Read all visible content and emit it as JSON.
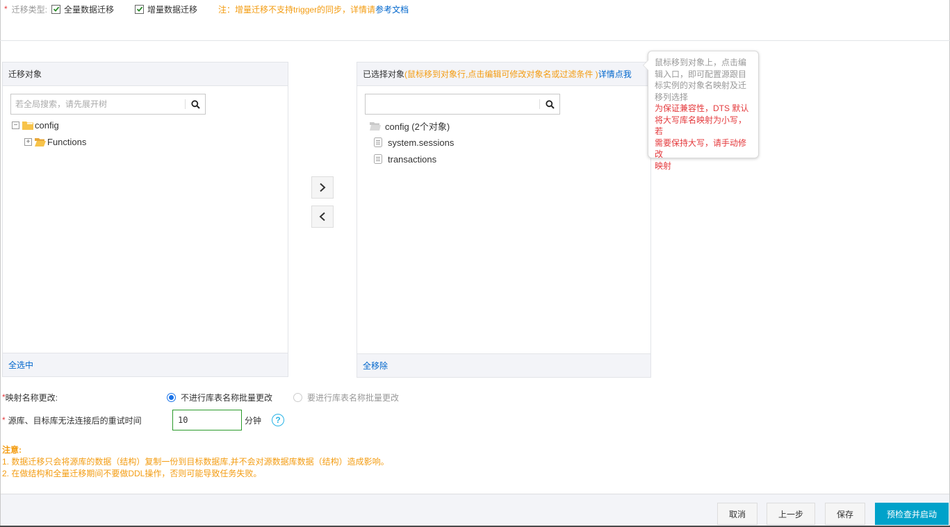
{
  "migration_type": {
    "required_mark": "*",
    "label": "迁移类型:",
    "options": [
      {
        "label": "全量数据迁移",
        "checked": true
      },
      {
        "label": "增量数据迁移",
        "checked": true
      }
    ],
    "note": "注：增量迁移不支持trigger的同步，详情请",
    "note_link": "参考文档"
  },
  "source_panel": {
    "title": "迁移对象",
    "search_placeholder": "若全局搜索，请先展开树",
    "search_value": "",
    "tree": [
      {
        "label": "config",
        "expanded": true,
        "level": 0
      },
      {
        "label": "Functions",
        "expanded": false,
        "level": 1
      }
    ],
    "footer_link": "全选中"
  },
  "transfer": {
    "add_icon": "chevron-right-icon",
    "remove_icon": "chevron-left-icon"
  },
  "selected_panel": {
    "title": "已选择对象",
    "hint": "(鼠标移到对象行,点击编辑可修改对象名或过滤条件 )",
    "detail_link": "详情点我",
    "search_placeholder": "",
    "search_value": "",
    "tree": [
      {
        "label": "config (2个对象)",
        "type": "folder"
      },
      {
        "label": "system.sessions",
        "type": "table"
      },
      {
        "label": "transactions",
        "type": "table"
      }
    ],
    "footer_link": "全移除"
  },
  "tooltip": {
    "gray_text": "鼠标移到对象上，点击编辑入口，即可配置源跟目标实例的对象名映射及迁移列选择",
    "red_text": "为保证兼容性，DTS 默认将大写库名映射为小写，若需要保持大写，请手动修改映射",
    "gray_lines": [
      "鼠标移到对象上，点击编",
      "辑入口，即可配置源跟目",
      "标实例的对象名映射及迁",
      "移列选择"
    ],
    "red_lines": [
      "为保证兼容性，DTS 默认",
      "将大写库名映射为小写，若",
      "需要保持大写，请手动修改",
      "映射"
    ]
  },
  "mapping": {
    "required_mark": "*",
    "label": "映射名称更改:",
    "options": [
      {
        "label": "不进行库表名称批量更改",
        "selected": true
      },
      {
        "label": "要进行库表名称批量更改",
        "selected": false
      }
    ]
  },
  "retry": {
    "required_mark": "*",
    "label": "源库、目标库无法连接后的重试时间",
    "value": "10",
    "unit": "分钟",
    "help_icon": "?"
  },
  "notes": {
    "title": "注意:",
    "items": [
      "1. 数据迁移只会将源库的数据（结构）复制一份到目标数据库,并不会对源数据库数据（结构）造成影响。",
      "2. 在做结构和全量迁移期间不要做DDL操作，否则可能导致任务失败。"
    ]
  },
  "footer": {
    "cancel": "取消",
    "previous": "上一步",
    "save": "保存",
    "precheck_start": "预检查并启动"
  },
  "colors": {
    "primary": "#00a2ca",
    "warning": "#f39c12",
    "link": "#0066cc",
    "required": "#e4393c",
    "radio": "#1a73e8",
    "input_border": "#2a9a2a",
    "help": "#27b3e6"
  }
}
